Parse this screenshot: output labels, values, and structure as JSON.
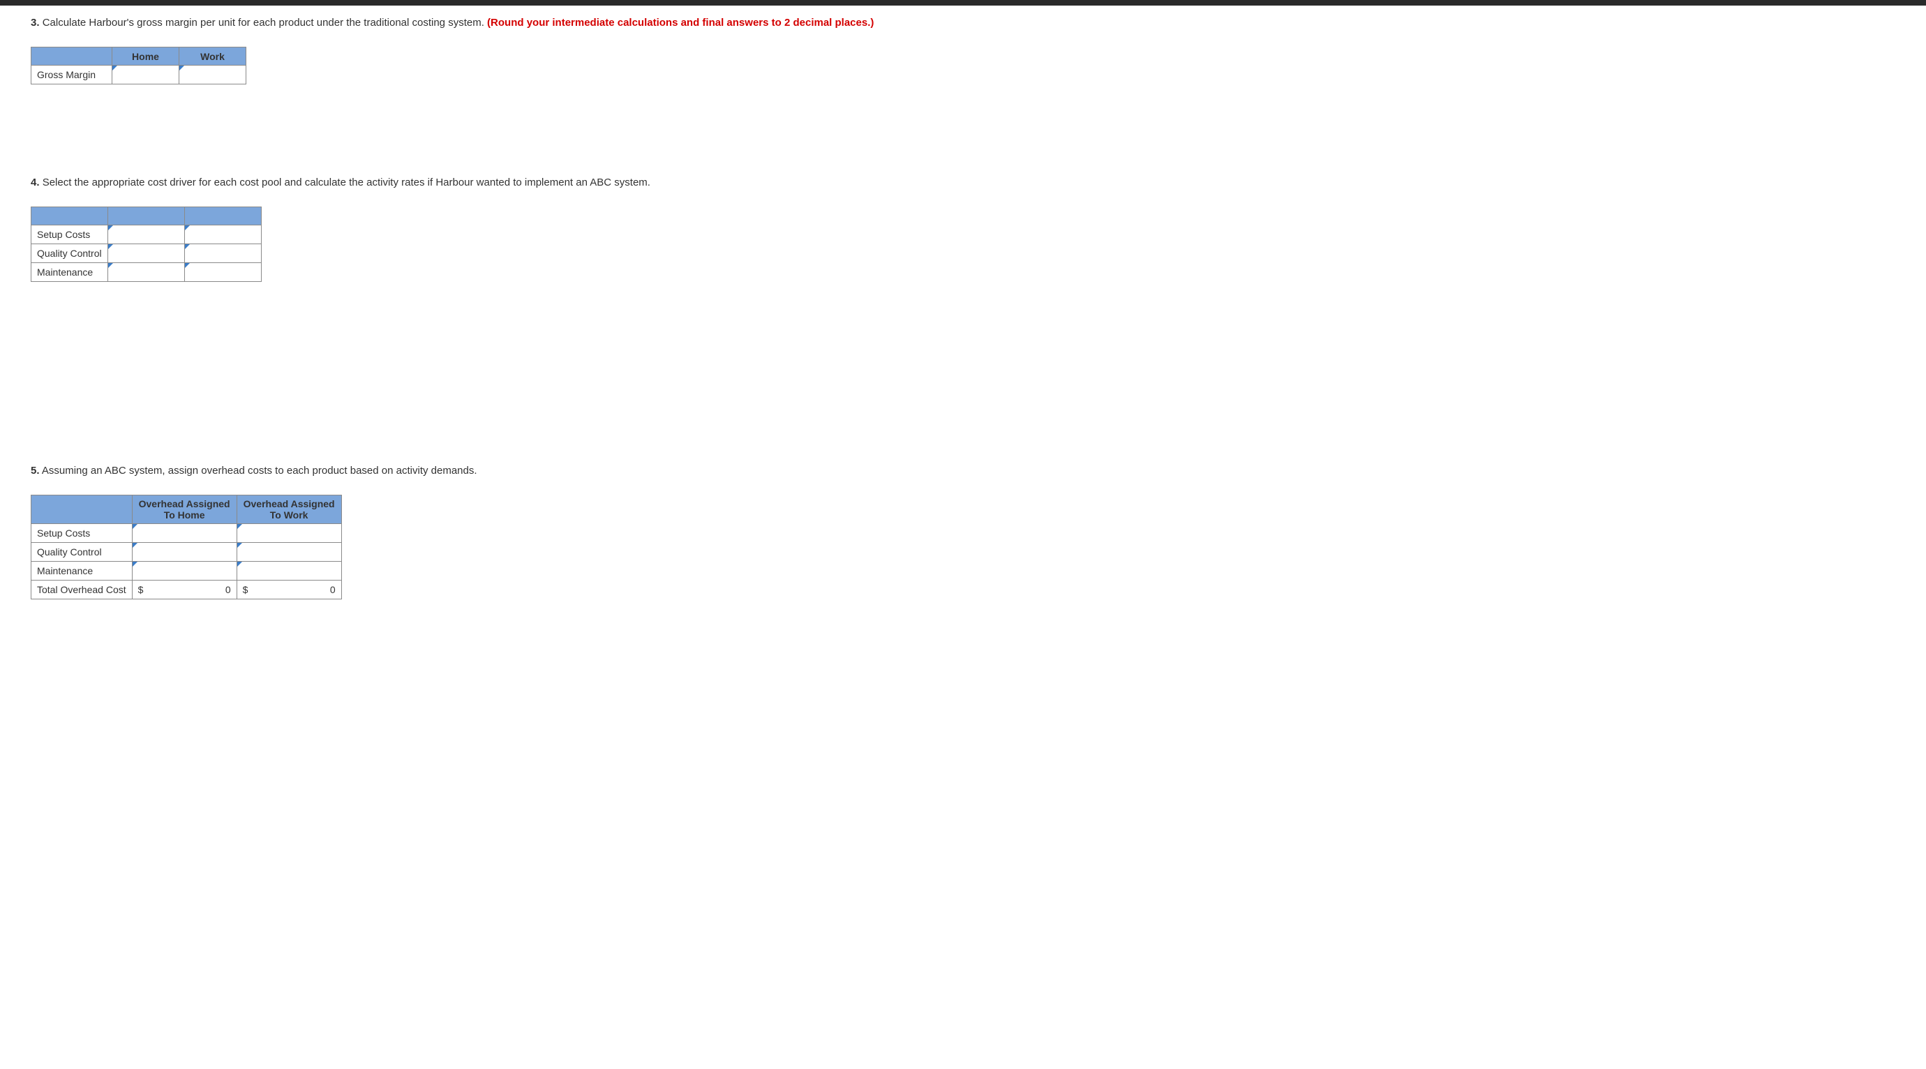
{
  "q3": {
    "number": "3.",
    "text": "Calculate Harbour's gross margin per unit for each product under the traditional costing system.",
    "instruction": "(Round your intermediate calculations and final answers to 2 decimal places.)",
    "table": {
      "headers": [
        "",
        "Home",
        "Work"
      ],
      "rows": [
        {
          "label": "Gross Margin",
          "cells": [
            "",
            ""
          ]
        }
      ]
    }
  },
  "q4": {
    "number": "4.",
    "text": "Select the appropriate cost driver for each cost pool and calculate the activity rates if Harbour wanted to implement an ABC system.",
    "table": {
      "headers": [
        "",
        "",
        ""
      ],
      "rows": [
        {
          "label": "Setup Costs",
          "cells": [
            "",
            ""
          ]
        },
        {
          "label": "Quality Control",
          "cells": [
            "",
            ""
          ]
        },
        {
          "label": "Maintenance",
          "cells": [
            "",
            ""
          ]
        }
      ]
    }
  },
  "q5": {
    "number": "5.",
    "text": "Assuming an ABC system, assign overhead costs to each product based on activity demands.",
    "table": {
      "headers": [
        "",
        "Overhead Assigned To Home",
        "Overhead Assigned To Work"
      ],
      "rows": [
        {
          "label": "Setup Costs",
          "cells": [
            "",
            ""
          ]
        },
        {
          "label": "Quality Control",
          "cells": [
            "",
            ""
          ]
        },
        {
          "label": "Maintenance",
          "cells": [
            "",
            ""
          ]
        }
      ],
      "total_row": {
        "label": "Total Overhead Cost",
        "cells": [
          {
            "currency": "$",
            "value": "0"
          },
          {
            "currency": "$",
            "value": "0"
          }
        ]
      }
    }
  }
}
